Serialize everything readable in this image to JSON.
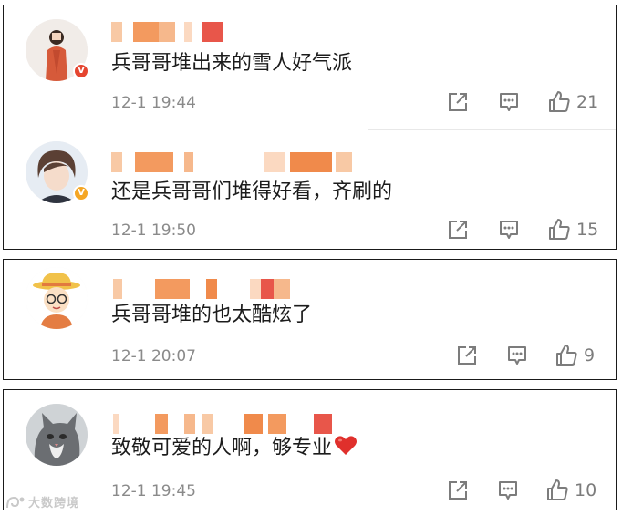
{
  "comments": [
    {
      "text": "兵哥哥堆出来的雪人好气派",
      "time": "12-1 19:44",
      "likes": "21",
      "badge": "V",
      "badge_color": "#e5452f",
      "avatar_icon": "woman-red-coat-avatar"
    },
    {
      "text": "还是兵哥哥们堆得好看，齐刷的",
      "time": "12-1 19:50",
      "likes": "15",
      "badge": "V",
      "badge_color": "#f5a623",
      "avatar_icon": "short-hair-portrait-avatar"
    },
    {
      "text": "兵哥哥堆的也太酷炫了",
      "time": "12-1 20:07",
      "likes": "9",
      "avatar_icon": "cartoon-boy-hat-avatar"
    },
    {
      "text": "致敬可爱的人啊，够专业",
      "time": "12-1 19:45",
      "likes": "10",
      "avatar_icon": "cat-avatar"
    }
  ],
  "icons": {
    "share": "share-icon",
    "comment": "comment-icon",
    "like": "like-icon",
    "heart": "heart-emoji-icon"
  },
  "colors": {
    "text": "#1c1c1c",
    "meta": "#8a8a8a",
    "heart": "#e0302c",
    "mosaic_orange": "#f08a4b"
  },
  "watermark": {
    "text": "大数跨境",
    "icon": "watermark-logo-icon"
  }
}
